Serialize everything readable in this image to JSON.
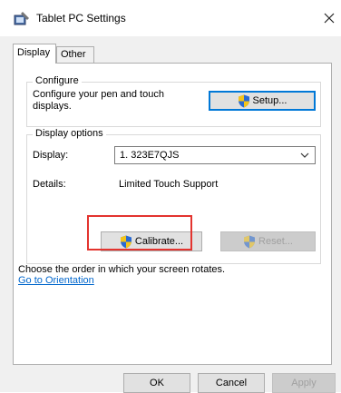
{
  "window": {
    "title": "Tablet PC Settings",
    "close_icon": "close-icon",
    "app_icon": "tablet-pen-icon"
  },
  "tabs": [
    {
      "label": "Display",
      "selected": true
    },
    {
      "label": "Other",
      "selected": false
    }
  ],
  "configure": {
    "legend": "Configure",
    "description": "Configure your pen and touch displays.",
    "setup_label": "Setup..."
  },
  "display_options": {
    "legend": "Display options",
    "display_label": "Display:",
    "display_value": "1. 323E7QJS",
    "details_label": "Details:",
    "details_value": "Limited Touch Support",
    "calibrate_label": "Calibrate...",
    "reset_label": "Reset..."
  },
  "orientation": {
    "text": "Choose the order in which your screen rotates.",
    "link": "Go to Orientation"
  },
  "footer": {
    "ok": "OK",
    "cancel": "Cancel",
    "apply": "Apply"
  },
  "colors": {
    "highlight": "#e3342f",
    "link": "#0066cc",
    "accent": "#0078d7"
  }
}
